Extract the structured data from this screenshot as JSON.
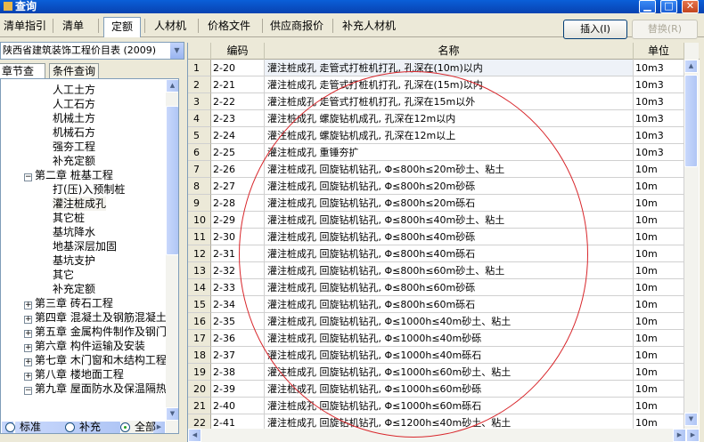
{
  "window": {
    "title": "查询"
  },
  "tabs": [
    {
      "label": "清单指引"
    },
    {
      "label": "清单"
    },
    {
      "label": "定额"
    },
    {
      "label": "人材机"
    },
    {
      "label": "价格文件"
    },
    {
      "label": "供应商报价"
    },
    {
      "label": "补充人材机"
    }
  ],
  "buttons": {
    "insert": "插入(I)",
    "replace": "替换(R)"
  },
  "left": {
    "combo_value": "陕西省建筑装饰工程价目表 (2009)",
    "tab_chapter": "章节查询",
    "tab_condition": "条件查询",
    "tree": [
      {
        "label": "人工土方"
      },
      {
        "label": "人工石方"
      },
      {
        "label": "机械土方"
      },
      {
        "label": "机械石方"
      },
      {
        "label": "强夯工程"
      },
      {
        "label": "补充定额"
      },
      {
        "label": "第二章  桩基工程"
      },
      {
        "label": "打(压)入预制桩"
      },
      {
        "label": "灌注桩成孔"
      },
      {
        "label": "其它桩"
      },
      {
        "label": "基坑降水"
      },
      {
        "label": "地基深层加固"
      },
      {
        "label": "基坑支护"
      },
      {
        "label": "其它"
      },
      {
        "label": "补充定额"
      },
      {
        "label": "第三章  砖石工程"
      },
      {
        "label": "第四章  混凝土及钢筋混凝土"
      },
      {
        "label": "第五章  金属构件制作及钢门"
      },
      {
        "label": "第六章  构件运输及安装"
      },
      {
        "label": "第七章  木门窗和木结构工程"
      },
      {
        "label": "第八章  楼地面工程"
      },
      {
        "label": "第九章  屋面防水及保温隔热"
      }
    ],
    "radios": [
      {
        "label": "标准"
      },
      {
        "label": "补充"
      },
      {
        "label": "全部"
      }
    ]
  },
  "grid": {
    "headers": {
      "code": "编码",
      "name": "名称",
      "unit": "单位"
    },
    "rows": [
      {
        "n": "1",
        "code": "2-20",
        "name": "灌注桩成孔  走管式打桩机打孔, 孔深在(10m)以内",
        "unit": "10m3"
      },
      {
        "n": "2",
        "code": "2-21",
        "name": "灌注桩成孔  走管式打桩机打孔, 孔深在(15m)以内",
        "unit": "10m3"
      },
      {
        "n": "3",
        "code": "2-22",
        "name": "灌注桩成孔  走管式打桩机打孔, 孔深在15m以外",
        "unit": "10m3"
      },
      {
        "n": "4",
        "code": "2-23",
        "name": "灌注桩成孔  螺旋钻机成孔, 孔深在12m以内",
        "unit": "10m3"
      },
      {
        "n": "5",
        "code": "2-24",
        "name": "灌注桩成孔  螺旋钻机成孔, 孔深在12m以上",
        "unit": "10m3"
      },
      {
        "n": "6",
        "code": "2-25",
        "name": "灌注桩成孔  重锤夯扩",
        "unit": "10m3"
      },
      {
        "n": "7",
        "code": "2-26",
        "name": "灌注桩成孔  回旋钻机钻孔, Φ≤800h≤20m砂土、粘土",
        "unit": "10m"
      },
      {
        "n": "8",
        "code": "2-27",
        "name": "灌注桩成孔  回旋钻机钻孔, Φ≤800h≤20m砂砾",
        "unit": "10m"
      },
      {
        "n": "9",
        "code": "2-28",
        "name": "灌注桩成孔  回旋钻机钻孔, Φ≤800h≤20m砾石",
        "unit": "10m"
      },
      {
        "n": "10",
        "code": "2-29",
        "name": "灌注桩成孔  回旋钻机钻孔, Φ≤800h≤40m砂土、粘土",
        "unit": "10m"
      },
      {
        "n": "11",
        "code": "2-30",
        "name": "灌注桩成孔  回旋钻机钻孔, Φ≤800h≤40m砂砾",
        "unit": "10m"
      },
      {
        "n": "12",
        "code": "2-31",
        "name": "灌注桩成孔  回旋钻机钻孔, Φ≤800h≤40m砾石",
        "unit": "10m"
      },
      {
        "n": "13",
        "code": "2-32",
        "name": "灌注桩成孔  回旋钻机钻孔, Φ≤800h≤60m砂土、粘土",
        "unit": "10m"
      },
      {
        "n": "14",
        "code": "2-33",
        "name": "灌注桩成孔  回旋钻机钻孔, Φ≤800h≤60m砂砾",
        "unit": "10m"
      },
      {
        "n": "15",
        "code": "2-34",
        "name": "灌注桩成孔  回旋钻机钻孔, Φ≤800h≤60m砾石",
        "unit": "10m"
      },
      {
        "n": "16",
        "code": "2-35",
        "name": "灌注桩成孔  回旋钻机钻孔, Φ≤1000h≤40m砂土、粘土",
        "unit": "10m"
      },
      {
        "n": "17",
        "code": "2-36",
        "name": "灌注桩成孔  回旋钻机钻孔, Φ≤1000h≤40m砂砾",
        "unit": "10m"
      },
      {
        "n": "18",
        "code": "2-37",
        "name": "灌注桩成孔  回旋钻机钻孔, Φ≤1000h≤40m砾石",
        "unit": "10m"
      },
      {
        "n": "19",
        "code": "2-38",
        "name": "灌注桩成孔  回旋钻机钻孔, Φ≤1000h≤60m砂土、粘土",
        "unit": "10m"
      },
      {
        "n": "20",
        "code": "2-39",
        "name": "灌注桩成孔  回旋钻机钻孔, Φ≤1000h≤60m砂砾",
        "unit": "10m"
      },
      {
        "n": "21",
        "code": "2-40",
        "name": "灌注桩成孔  回旋钻机钻孔, Φ≤1000h≤60m砾石",
        "unit": "10m"
      },
      {
        "n": "22",
        "code": "2-41",
        "name": "灌注桩成孔  回旋钻机钻孔, Φ≤1200h≤40m砂土、粘土",
        "unit": "10m"
      }
    ]
  }
}
